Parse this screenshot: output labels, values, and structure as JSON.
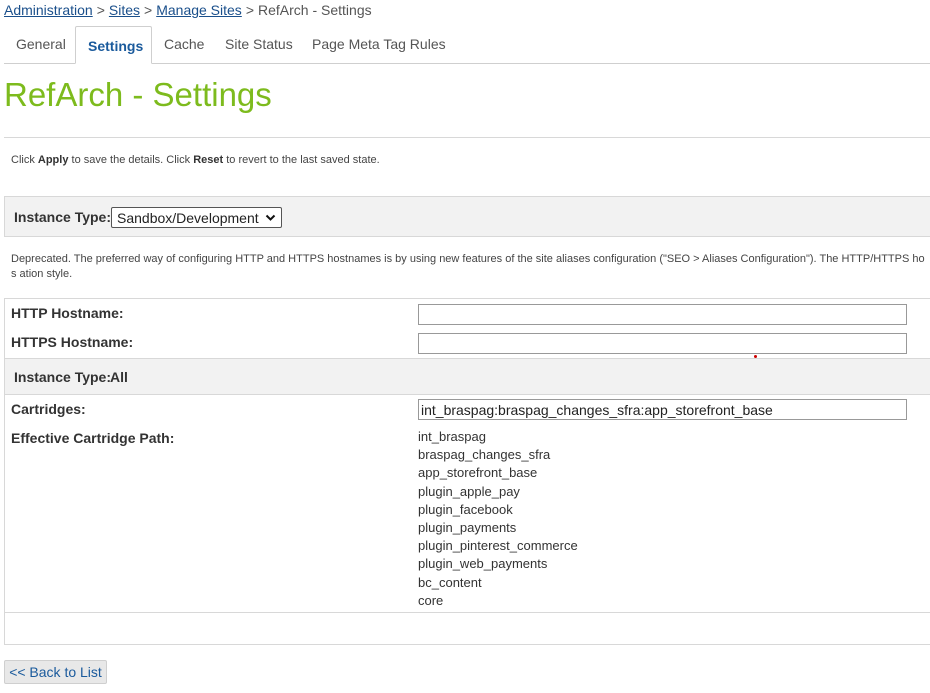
{
  "breadcrumb": {
    "items": [
      "Administration",
      "Sites",
      "Manage Sites"
    ],
    "current": "RefArch - Settings",
    "separator": ">"
  },
  "tabs": [
    "General",
    "Settings",
    "Cache",
    "Site Status",
    "Page Meta Tag Rules"
  ],
  "page_title": "RefArch - Settings",
  "help": {
    "part1": "Click ",
    "apply": "Apply",
    "part2": " to save the details. Click ",
    "reset": "Reset",
    "part3": " to revert to the last saved state."
  },
  "instance_type": {
    "label": "Instance Type:",
    "selected": "Sandbox/Development"
  },
  "deprecated_text": "Deprecated. The preferred way of configuring HTTP and HTTPS hostnames is by using new features of the site aliases configuration (\"SEO > Aliases Configuration\"). The HTTP/HTTPS hos ation style.",
  "http_hostname": {
    "label": "HTTP Hostname:",
    "value": ""
  },
  "https_hostname": {
    "label": "HTTPS Hostname:",
    "value": ""
  },
  "instance_type_all": {
    "label": "Instance Type:",
    "value": "All"
  },
  "cartridges": {
    "label": "Cartridges:",
    "value": "int_braspag:braspag_changes_sfra:app_storefront_base"
  },
  "effective_path": {
    "label": "Effective Cartridge Path:",
    "items": [
      "int_braspag",
      "braspag_changes_sfra",
      "app_storefront_base",
      "plugin_apple_pay",
      "plugin_facebook",
      "plugin_payments",
      "plugin_pinterest_commerce",
      "plugin_web_payments",
      "bc_content",
      "core"
    ]
  },
  "back_button": "<< Back to List",
  "colors": {
    "title": "#7dbb1d",
    "link": "#1a4f8b",
    "tab_active": "#1a5a9c"
  }
}
